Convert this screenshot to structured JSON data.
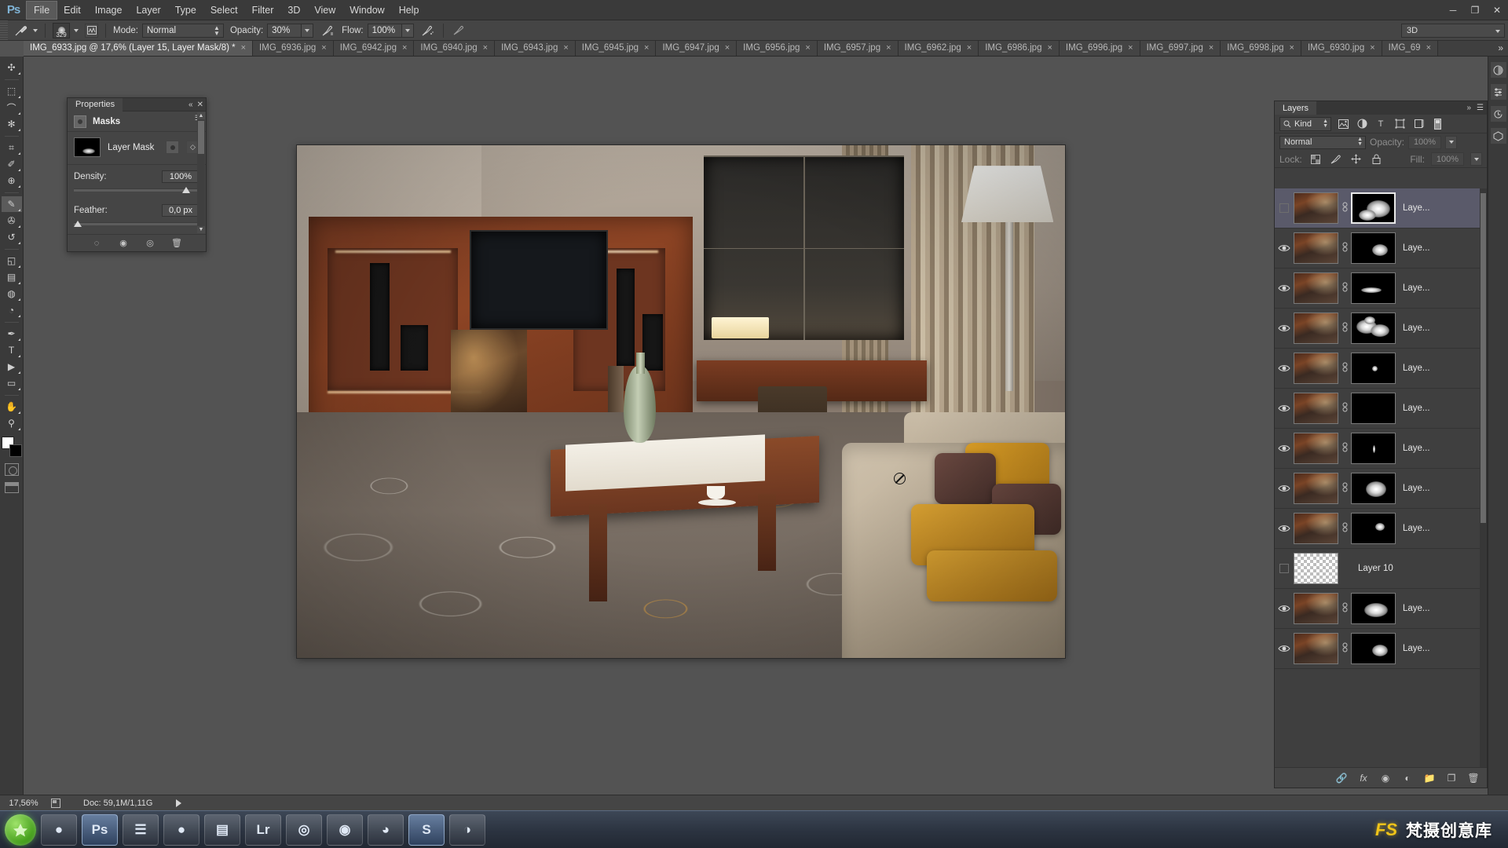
{
  "app": {
    "logo": "Ps"
  },
  "menubar": {
    "items": [
      {
        "label": "File",
        "active": true
      },
      {
        "label": "Edit",
        "active": false
      },
      {
        "label": "Image",
        "active": false
      },
      {
        "label": "Layer",
        "active": false
      },
      {
        "label": "Type",
        "active": false
      },
      {
        "label": "Select",
        "active": false
      },
      {
        "label": "Filter",
        "active": false
      },
      {
        "label": "3D",
        "active": false
      },
      {
        "label": "View",
        "active": false
      },
      {
        "label": "Window",
        "active": false
      },
      {
        "label": "Help",
        "active": false
      }
    ],
    "window_buttons": [
      "minimize-icon",
      "restore-icon",
      "close-icon"
    ]
  },
  "options_bar": {
    "brush_size": "329",
    "mode_label": "Mode:",
    "mode_value": "Normal",
    "opacity_label": "Opacity:",
    "opacity_value": "30%",
    "flow_label": "Flow:",
    "flow_value": "100%",
    "workspace_value": "3D",
    "airbrush_icon": "airbrush-icon",
    "tablet_pressure_icon": "tablet-pressure-icon",
    "brush_panel_icon": "brush-panel-icon"
  },
  "tabs": {
    "items": [
      {
        "label": "IMG_6933.jpg @ 17,6% (Layer 15, Layer Mask/8) *",
        "active": true
      },
      {
        "label": "IMG_6936.jpg",
        "active": false
      },
      {
        "label": "IMG_6942.jpg",
        "active": false
      },
      {
        "label": "IMG_6940.jpg",
        "active": false
      },
      {
        "label": "IMG_6943.jpg",
        "active": false
      },
      {
        "label": "IMG_6945.jpg",
        "active": false
      },
      {
        "label": "IMG_6947.jpg",
        "active": false
      },
      {
        "label": "IMG_6956.jpg",
        "active": false
      },
      {
        "label": "IMG_6957.jpg",
        "active": false
      },
      {
        "label": "IMG_6962.jpg",
        "active": false
      },
      {
        "label": "IMG_6986.jpg",
        "active": false
      },
      {
        "label": "IMG_6996.jpg",
        "active": false
      },
      {
        "label": "IMG_6997.jpg",
        "active": false
      },
      {
        "label": "IMG_6998.jpg",
        "active": false
      },
      {
        "label": "IMG_6930.jpg",
        "active": false
      },
      {
        "label": "IMG_69",
        "active": false
      }
    ],
    "overflow_label": "»",
    "close_glyph": "×"
  },
  "toolbar": {
    "tools": [
      {
        "name": "move-tool",
        "glyph": "✣",
        "selected": false
      },
      {
        "name": "marquee-tool",
        "glyph": "⬚",
        "selected": false
      },
      {
        "name": "lasso-tool",
        "glyph": "⌒",
        "selected": false
      },
      {
        "name": "quick-selection-tool",
        "glyph": "✻",
        "selected": false
      },
      {
        "name": "crop-tool",
        "glyph": "⌗",
        "selected": false
      },
      {
        "name": "eyedropper-tool",
        "glyph": "✐",
        "selected": false
      },
      {
        "name": "spot-healing-tool",
        "glyph": "⊕",
        "selected": false
      },
      {
        "name": "brush-tool",
        "glyph": "✎",
        "selected": true
      },
      {
        "name": "clone-stamp-tool",
        "glyph": "✇",
        "selected": false
      },
      {
        "name": "history-brush-tool",
        "glyph": "↺",
        "selected": false
      },
      {
        "name": "eraser-tool",
        "glyph": "◱",
        "selected": false
      },
      {
        "name": "gradient-tool",
        "glyph": "▤",
        "selected": false
      },
      {
        "name": "blur-tool",
        "glyph": "◍",
        "selected": false
      },
      {
        "name": "dodge-tool",
        "glyph": "◔",
        "selected": false
      },
      {
        "name": "pen-tool",
        "glyph": "✒",
        "selected": false
      },
      {
        "name": "type-tool",
        "glyph": "T",
        "selected": false
      },
      {
        "name": "path-selection-tool",
        "glyph": "▶",
        "selected": false
      },
      {
        "name": "rectangle-tool",
        "glyph": "▭",
        "selected": false
      },
      {
        "name": "hand-tool",
        "glyph": "✋",
        "selected": false
      },
      {
        "name": "zoom-tool",
        "glyph": "⚲",
        "selected": false
      }
    ],
    "foreground_color": "#ffffff",
    "background_color": "#000000",
    "quick_mask_icon": "quick-mask-icon",
    "screen_mode_icon": "screen-mode-icon"
  },
  "right_strip": {
    "icons": [
      "color-panel-icon",
      "adjustments-panel-icon",
      "history-panel-icon",
      "3d-panel-icon"
    ]
  },
  "properties_panel": {
    "tab_label": "Properties",
    "header_title": "Masks",
    "header_icon": "mask-icon",
    "mask_label": "Layer Mask",
    "pixel_mask_icon": "pixel-mask-icon",
    "vector_mask_icon": "vector-mask-icon",
    "density_label": "Density:",
    "density_value": "100%",
    "feather_label": "Feather:",
    "feather_value": "0,0 px",
    "footer_icons": [
      "load-selection-icon",
      "apply-mask-icon",
      "disable-mask-icon",
      "delete-mask-icon"
    ]
  },
  "layers_panel": {
    "tab_label": "Layers",
    "collapse_icon": "collapse-icon",
    "menu_icon": "panel-menu-icon",
    "filter_kind_label": "Kind",
    "filter_icons": [
      "pixel-filter-icon",
      "adjustment-filter-icon",
      "type-filter-icon",
      "shape-filter-icon",
      "smart-object-filter-icon",
      "filter-toggle-icon"
    ],
    "blend_mode": "Normal",
    "opacity_label": "Opacity:",
    "opacity_value": "100%",
    "lock_label": "Lock:",
    "lock_icons": [
      "lock-transparency-icon",
      "lock-image-icon",
      "lock-position-icon",
      "lock-all-icon"
    ],
    "fill_label": "Fill:",
    "fill_value": "100%",
    "rows": [
      {
        "name": "Laye...",
        "visible": false,
        "selected": true,
        "mask": "big",
        "has_mask": true,
        "transparent": false
      },
      {
        "name": "Laye...",
        "visible": true,
        "selected": false,
        "mask": "medium",
        "has_mask": true,
        "transparent": false
      },
      {
        "name": "Laye...",
        "visible": true,
        "selected": false,
        "mask": "streak",
        "has_mask": true,
        "transparent": false
      },
      {
        "name": "Laye...",
        "visible": true,
        "selected": false,
        "mask": "cluster",
        "has_mask": true,
        "transparent": false
      },
      {
        "name": "Laye...",
        "visible": true,
        "selected": false,
        "mask": "dot",
        "has_mask": true,
        "transparent": false
      },
      {
        "name": "Laye...",
        "visible": true,
        "selected": false,
        "mask": "none",
        "has_mask": true,
        "transparent": false
      },
      {
        "name": "Laye...",
        "visible": true,
        "selected": false,
        "mask": "tiny",
        "has_mask": true,
        "transparent": false
      },
      {
        "name": "Laye...",
        "visible": true,
        "selected": false,
        "mask": "soft",
        "has_mask": true,
        "transparent": false
      },
      {
        "name": "Laye...",
        "visible": true,
        "selected": false,
        "mask": "small",
        "has_mask": true,
        "transparent": false
      },
      {
        "name": "Layer 10",
        "visible": false,
        "selected": false,
        "mask": "none",
        "has_mask": false,
        "transparent": true
      },
      {
        "name": "Laye...",
        "visible": true,
        "selected": false,
        "mask": "blobby",
        "has_mask": true,
        "transparent": false
      },
      {
        "name": "Laye...",
        "visible": true,
        "selected": false,
        "mask": "medium",
        "has_mask": true,
        "transparent": false
      }
    ],
    "footer_icons": [
      "link-layers-icon",
      "layer-style-icon",
      "add-mask-icon",
      "adjustment-layer-icon",
      "new-group-icon",
      "new-layer-icon",
      "delete-layer-icon"
    ]
  },
  "status_bar": {
    "zoom": "17,56%",
    "doc_icon": "document-icon",
    "doc_info": "Doc: 59,1M/1,11G",
    "expand_icon": "expand-arrow-icon"
  },
  "taskbar": {
    "start_label": "start-button",
    "buttons": [
      {
        "name": "taskbar-media-player",
        "glyph": "●",
        "active": false
      },
      {
        "name": "taskbar-photoshop",
        "glyph": "Ps",
        "active": true
      },
      {
        "name": "taskbar-file-manager",
        "glyph": "☰",
        "active": false
      },
      {
        "name": "taskbar-disc",
        "glyph": "●",
        "active": false
      },
      {
        "name": "taskbar-folder",
        "glyph": "▤",
        "active": false
      },
      {
        "name": "taskbar-lightroom",
        "glyph": "Lr",
        "active": false
      },
      {
        "name": "taskbar-chrome",
        "glyph": "◎",
        "active": false
      },
      {
        "name": "taskbar-browser",
        "glyph": "◉",
        "active": false
      },
      {
        "name": "taskbar-firefox",
        "glyph": "◕",
        "active": false
      },
      {
        "name": "taskbar-skype",
        "glyph": "S",
        "active": true
      },
      {
        "name": "taskbar-app",
        "glyph": "◑",
        "active": false
      }
    ],
    "brand_mark": "fs-logo-icon",
    "brand_text": "梵摄创意库"
  },
  "canvas": {
    "cursor_icon": "no-drop-cursor-icon",
    "document_name": "IMG_6933.jpg"
  }
}
